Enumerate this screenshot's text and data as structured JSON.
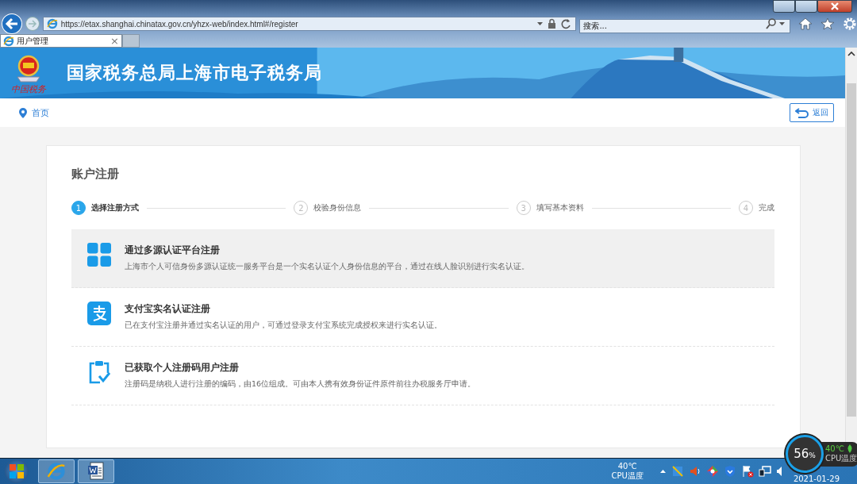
{
  "browser": {
    "address": "https://etax.shanghai.chinatax.gov.cn/yhzx-web/index.html#/register",
    "search": {
      "placeholder": "搜索..."
    },
    "tabs": [
      {
        "label": "用户管理",
        "close": "×",
        "selected": true
      }
    ]
  },
  "banner": {
    "title": "国家税务总局上海市电子税务局",
    "logo_text": "中国税务"
  },
  "nav": {
    "breadcrumb": "首页",
    "back": "返回"
  },
  "card": {
    "title": "账户注册",
    "steps": [
      {
        "number": "1",
        "label": "选择注册方式",
        "selected": true
      },
      {
        "number": "2",
        "label": "校验身份信息",
        "selected": false
      },
      {
        "number": "3",
        "label": "填写基本资料",
        "selected": false
      },
      {
        "number": "4",
        "label": "完成",
        "selected": false
      }
    ],
    "options": [
      {
        "kind": "grid",
        "title": "通过多源认证平台注册",
        "description": "上海市个人可信身份多源认证统一服务平台是一个实名认证个人身份信息的平台，通过在线人脸识别进行实名认证。",
        "selected": true
      },
      {
        "kind": "alipay",
        "title": "支付宝实名认证注册",
        "description": "已在支付宝注册并通过实名认证的用户，可通过登录支付宝系统完成授权来进行实名认证。",
        "selected": false
      },
      {
        "kind": "clipboard",
        "title": "已获取个人注册码用户注册",
        "description": "注册码是纳税人进行注册的编码，由16位组成。可由本人携有效身份证件原件前往办税服务厅申请。",
        "selected": false
      }
    ]
  },
  "taskbar": {
    "temperature": "40℃",
    "temperature_label": "CPU温度",
    "date": "2021-01-29"
  },
  "cpu_widget": {
    "percent": "56",
    "unit": "%",
    "temperature": "40℃",
    "label": "CPU温度"
  }
}
